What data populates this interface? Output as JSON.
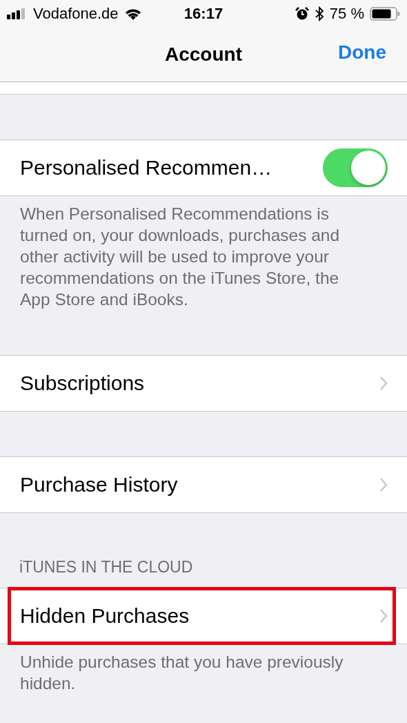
{
  "status_bar": {
    "carrier": "Vodafone.de",
    "time": "16:17",
    "battery": "75 %"
  },
  "nav": {
    "title": "Account",
    "action": "Done"
  },
  "sections": [
    {
      "rows": [
        {
          "kind": "toggle",
          "label": "Personalised Recommen…",
          "on": true
        }
      ],
      "footer": "When Personalised Recommendations is turned on, your downloads, purchases and other activity will be used to improve your recommendations on the iTunes Store, the App Store and iBooks."
    },
    {
      "rows": [
        {
          "kind": "link",
          "label": "Subscriptions",
          "highlighted": false
        }
      ]
    },
    {
      "rows": [
        {
          "kind": "link",
          "label": "Purchase History",
          "highlighted": false
        }
      ]
    },
    {
      "header": "iTUNES IN THE CLOUD",
      "rows": [
        {
          "kind": "link",
          "label": "Hidden Purchases",
          "highlighted": true
        }
      ],
      "footer": "Unhide purchases that you have previously hidden."
    }
  ]
}
